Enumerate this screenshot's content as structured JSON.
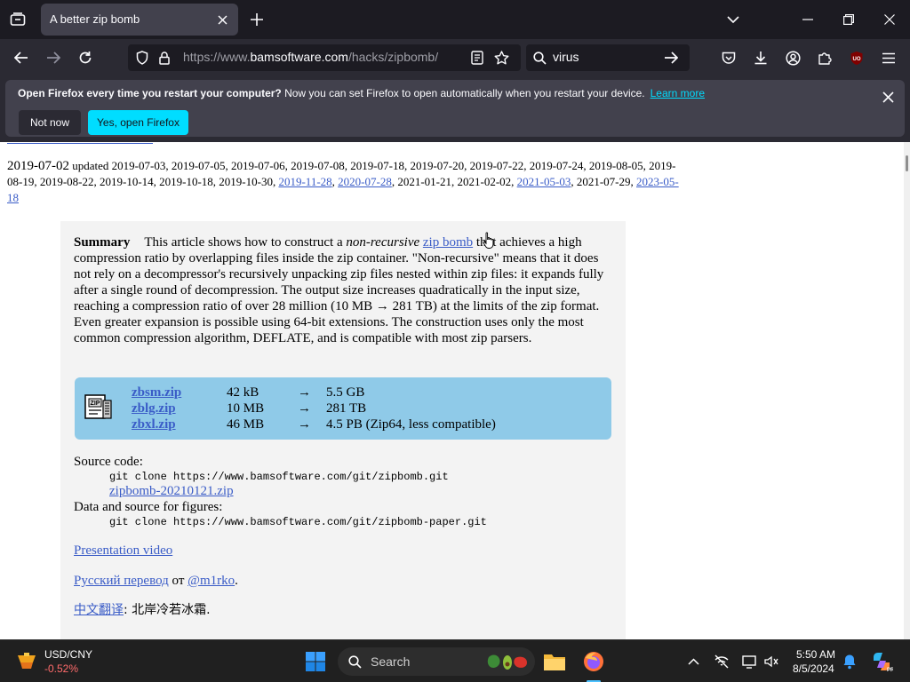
{
  "browser": {
    "tab_title": "A better zip bomb",
    "url_prefix": "https://www.",
    "url_host": "bamsoftware.com",
    "url_path": "/hacks/zipbomb/",
    "search_value": "virus"
  },
  "notification": {
    "bold": "Open Firefox every time you restart your computer?",
    "text": " Now you can set Firefox to open automatically when you restart your device.",
    "learn_more": "Learn more",
    "not_now": "Not now",
    "yes_open": "Yes, open Firefox"
  },
  "page": {
    "date": "2019-07-02",
    "updated_label": "updated",
    "dates_1": " 2019-07-03, 2019-07-05, 2019-07-06, 2019-07-08, 2019-07-18, 2019-07-20, 2019-07-22, 2019-07-24, 2019-08-05, 2019-08-19, 2019-08-22, 2019-10-14, 2019-10-18, 2019-10-30, ",
    "date_link_1": "2019-11-28",
    "date_link_2": "2020-07-28",
    "dates_2": ", 2021-01-21, 2021-02-02, ",
    "date_link_3": "2021-05-03",
    "dates_3": ", 2021-07-29, ",
    "date_link_4": "2023-05-18",
    "summary_label": "Summary",
    "summary_a": "This article shows how to construct a ",
    "summary_em": "non-recursive",
    "summary_link": "zip bomb",
    "summary_b": " that achieves a high compression ratio by overlapping files inside the zip container. \"Non-recursive\" means that it does not rely on a decompressor's recursively unpacking zip files nested within zip files: it expands fully after a single round of decompression. The output size increases quadratically in the input size, reaching a compression ratio of over 28 million (10 MB → 281 TB) at the limits of the zip format. Even greater expansion is possible using 64-bit extensions. The construction uses only the most common compression algorithm, DEFLATE, and is compatible with most zip parsers.",
    "files": [
      {
        "name": "zbsm.zip",
        "size": "42 kB",
        "arrow": "→",
        "output": "5.5 GB"
      },
      {
        "name": "zblg.zip",
        "size": "10 MB",
        "arrow": "→",
        "output": "281 TB"
      },
      {
        "name": "zbxl.zip",
        "size": "46 MB",
        "arrow": "→",
        "output": "4.5 PB (Zip64, less compatible)"
      }
    ],
    "source_label": "Source code:",
    "source_cmd": "git clone https://www.bamsoftware.com/git/zipbomb.git",
    "source_zip": "zipbomb-20210121.zip",
    "data_label": "Data and source for figures:",
    "data_cmd": "git clone https://www.bamsoftware.com/git/zipbomb-paper.git",
    "video_link": "Presentation video",
    "ru_link": "Русский перевод",
    "ru_by": " от ",
    "ru_author": "@m1rko",
    "ru_end": ".",
    "zh_link": "中文翻译",
    "zh_rest": ": 北岸冷若冰霜."
  },
  "taskbar": {
    "widget_title": "USD/CNY",
    "widget_value": "-0.52%",
    "search_label": "Search",
    "time": "5:50 AM",
    "date": "8/5/2024"
  },
  "colors": {
    "accent": "#00ddff",
    "link": "#3a5cc7",
    "files_box": "#8fcae8"
  }
}
